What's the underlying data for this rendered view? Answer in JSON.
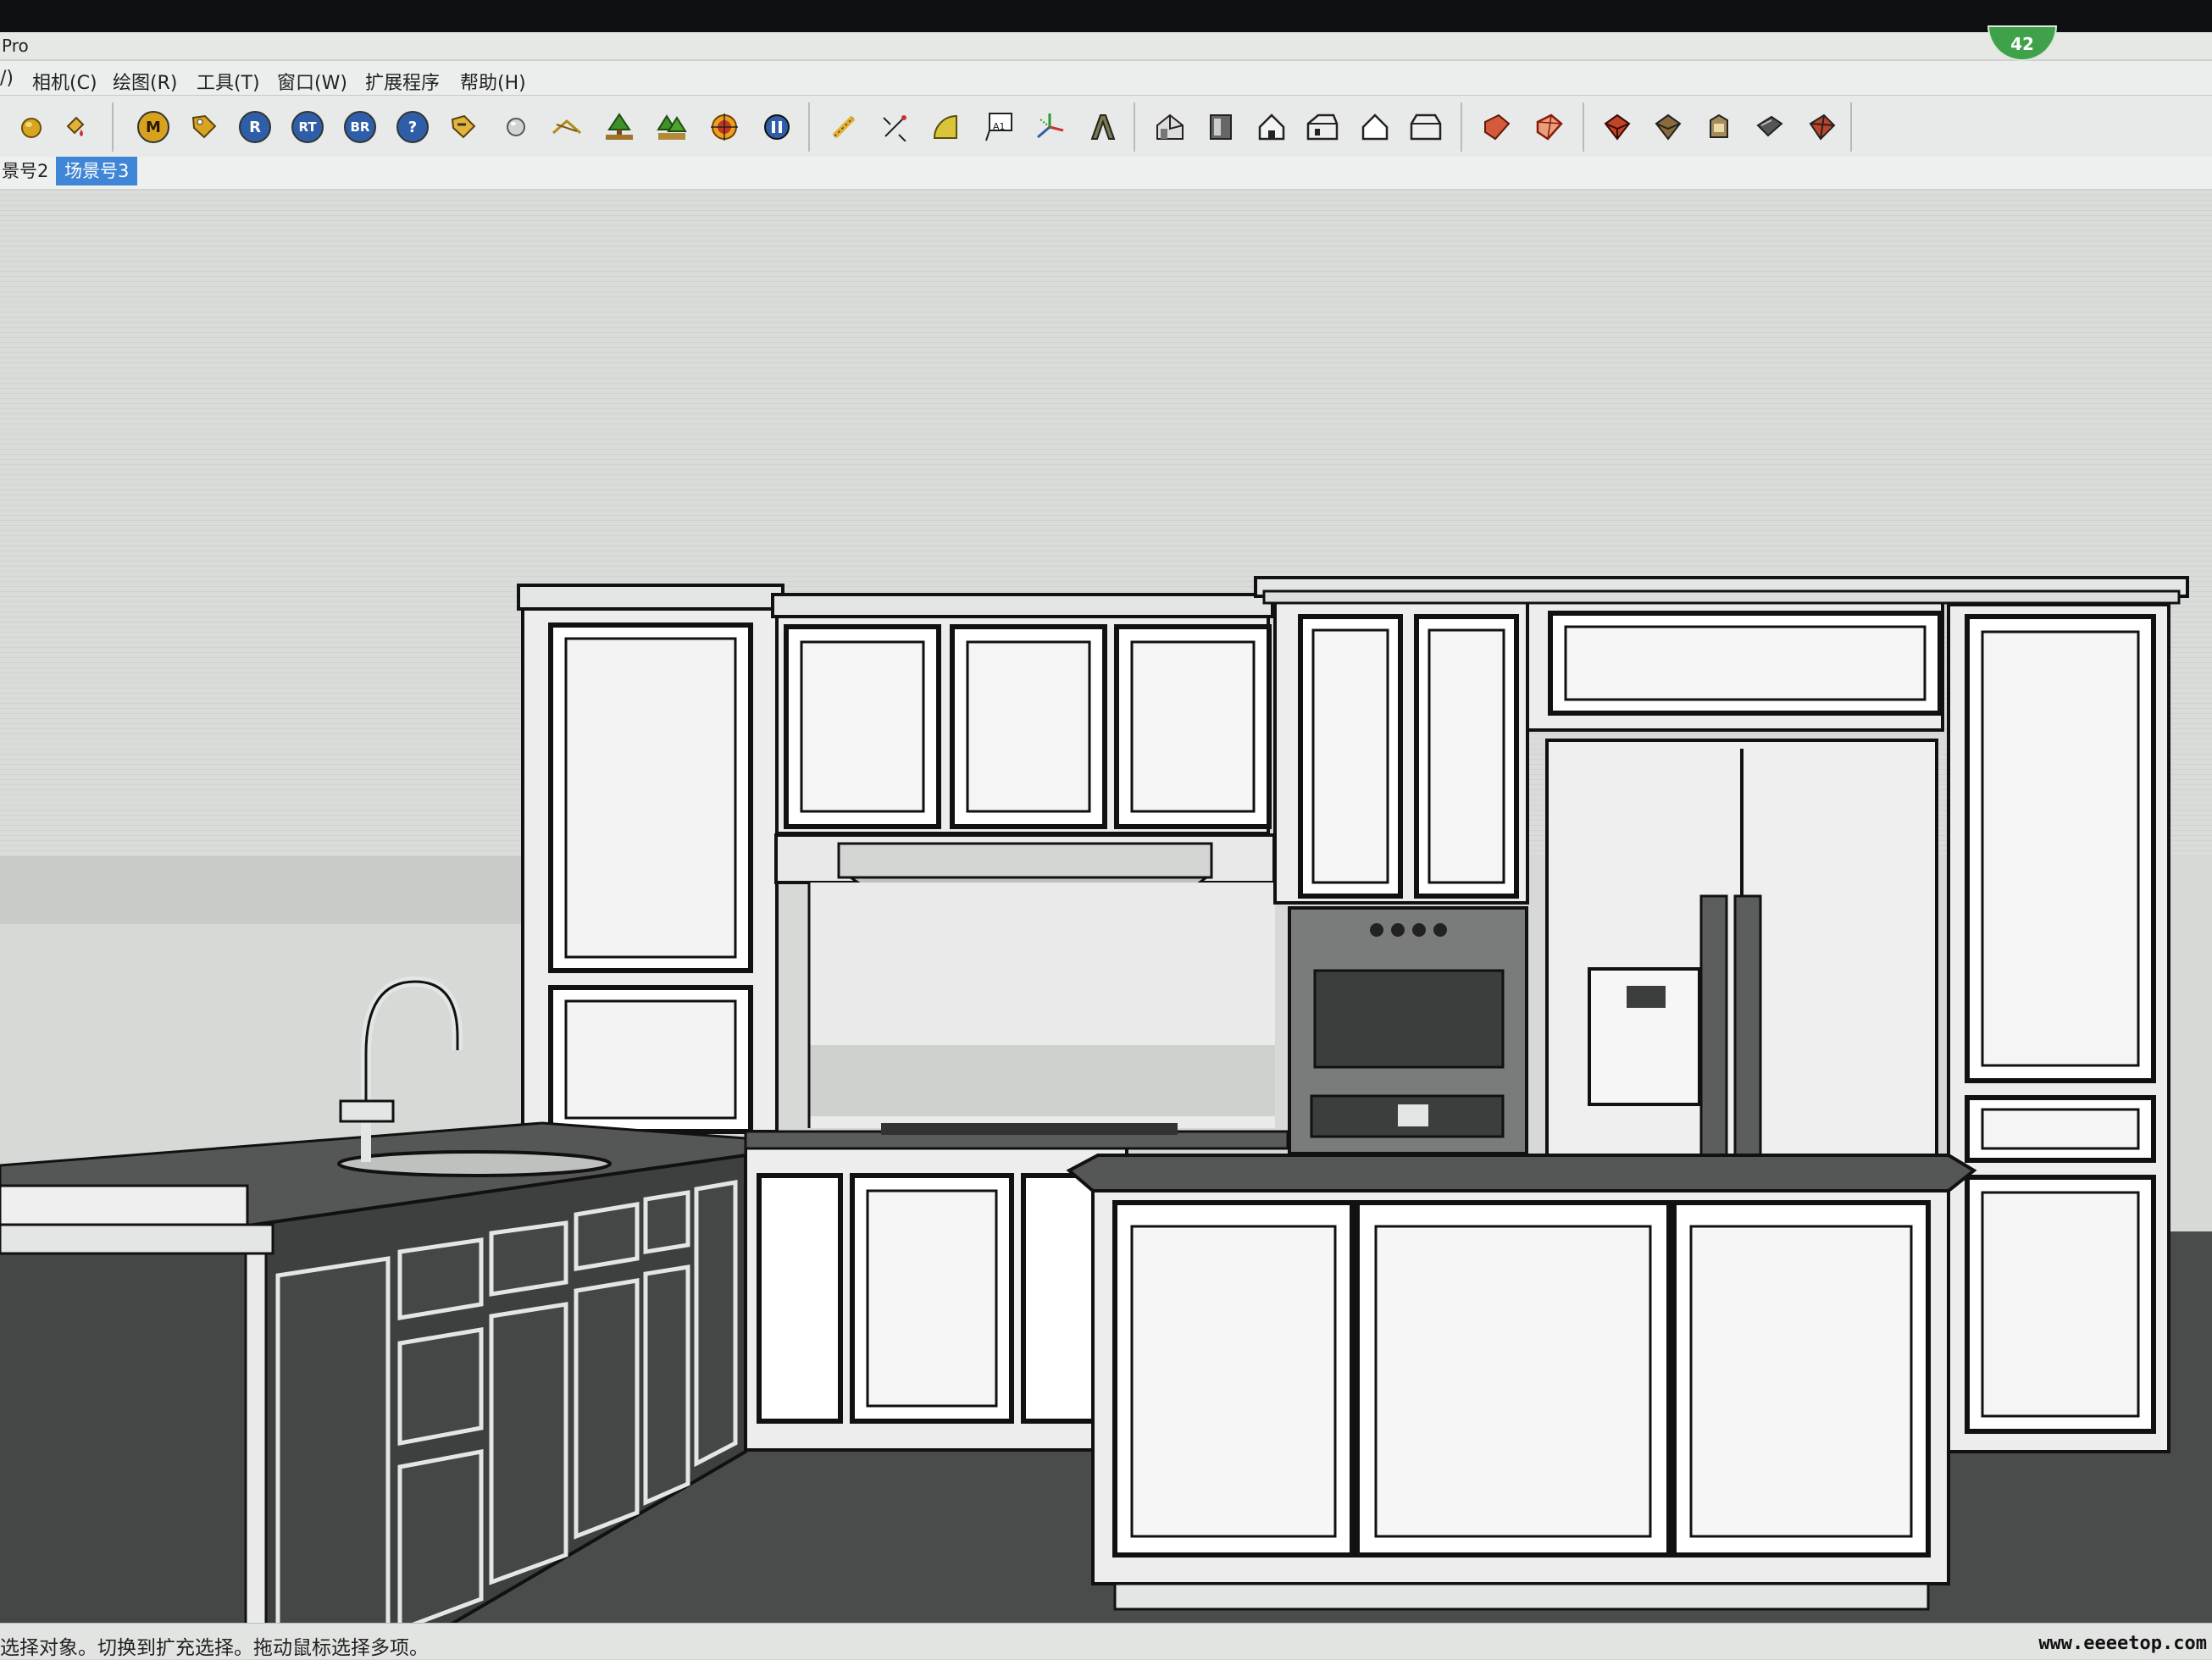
{
  "window": {
    "title": "Pro",
    "badge_count": "42"
  },
  "menu": [
    {
      "label": "/)"
    },
    {
      "label": "相机(C)"
    },
    {
      "label": "绘图(R)"
    },
    {
      "label": "工具(T)"
    },
    {
      "label": "窗口(W)"
    },
    {
      "label": "扩展程序"
    },
    {
      "label": "帮助(H)"
    }
  ],
  "toolbar": {
    "plugin_labels": {
      "m": "M",
      "r": "R",
      "rt": "RT",
      "br": "BR",
      "help": "?",
      "text": "A1"
    },
    "icons": [
      "orbit-sphere-icon",
      "paint-bucket-icon",
      "m-plugin-icon",
      "tag-plugin-icon",
      "r-plugin-icon",
      "rt-plugin-icon",
      "br-plugin-icon",
      "help-icon",
      "tag-edit-icon",
      "sphere-icon",
      "section-icon",
      "tree-icon",
      "forest-icon",
      "target-icon",
      "pause-icon",
      "tape-measure-icon",
      "dimension-icon",
      "protractor-icon",
      "text-icon",
      "axes-icon",
      "3d-text-icon",
      "iso-view-icon",
      "top-view-icon",
      "front-view-icon",
      "right-view-icon",
      "back-view-icon",
      "left-view-icon",
      "xray-icon",
      "wireframe-icon",
      "hidden-line-icon",
      "shaded-icon",
      "textured-icon",
      "monochrome-icon",
      "styles-icon",
      "section-plane-icon"
    ]
  },
  "scenes": [
    {
      "label": "景号2",
      "active": false
    },
    {
      "label": "场景号3",
      "active": true
    }
  ],
  "status": {
    "text": "选择对象。切换到扩充选择。拖动鼠标选择多项。",
    "watermark": "www.eeeetop.com"
  },
  "colors": {
    "accent": "#3f86d6",
    "badge": "#3fa14a",
    "floor": "#4a4c4b",
    "countertop": "#545655",
    "cabinet_face": "#e8eae9",
    "dark_cabinet": "#3e403f"
  }
}
